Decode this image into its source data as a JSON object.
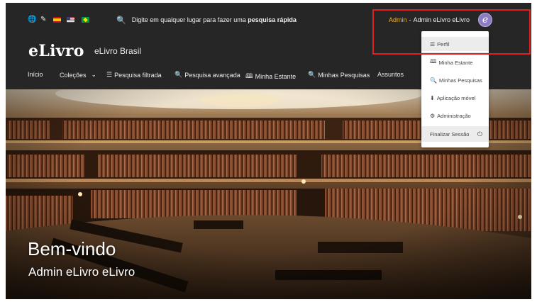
{
  "topbar": {
    "icons": [
      "globe-icon",
      "pen-icon"
    ],
    "flags": [
      "flag-es-icon",
      "flag-us-icon",
      "flag-br-icon"
    ],
    "quick_search": {
      "prefix": "Digite em qualquer lugar para fazer uma ",
      "bold": "pesquisa rápida"
    },
    "user": {
      "role": "Admin",
      "separator": "-",
      "name": "Admin eLivro eLivro",
      "avatar_letter": "e"
    }
  },
  "brand": {
    "logo_e": "e",
    "logo_rest": "Livro",
    "site_name": "eLivro Brasil"
  },
  "nav": {
    "items": [
      {
        "label": "Início"
      },
      {
        "label": "Coleções",
        "caret": "⌄"
      },
      {
        "label": "Pesquisa filtrada",
        "icon": "☰"
      },
      {
        "label": "Pesquisa avançada",
        "icon": "🔍"
      },
      {
        "label": "Minha Estante",
        "icon": "🕮"
      },
      {
        "label": "Minhas Pesquisas",
        "icon": "🔍"
      },
      {
        "label": "Assuntos"
      }
    ]
  },
  "dropdown": {
    "items": [
      {
        "label": "Perfil",
        "icon": "☰"
      },
      {
        "label": "Minha Estante",
        "icon": "🕮"
      },
      {
        "label": "Minhas Pesquisas",
        "icon": "🔍"
      },
      {
        "label": "Aplicação móvel",
        "icon": "⬇"
      },
      {
        "label": "Administração",
        "icon": "⚙"
      },
      {
        "label": "Finalizar Sessão",
        "icon": "⏻"
      }
    ]
  },
  "hero": {
    "welcome": "Bem-vindo",
    "user_name": "Admin eLivro eLivro"
  },
  "colors": {
    "topbar_bg": "#262626",
    "role_color": "#f3b128",
    "avatar_bg": "#8e7cc3",
    "highlight_border": "#e02020"
  }
}
